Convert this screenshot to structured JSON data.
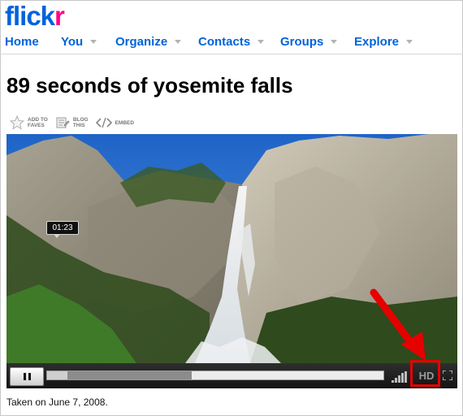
{
  "logo": {
    "main": "flick",
    "accent": "r"
  },
  "nav": {
    "items": [
      {
        "label": "Home",
        "has_menu": false
      },
      {
        "label": "You",
        "has_menu": true
      },
      {
        "label": "Organize",
        "has_menu": true
      },
      {
        "label": "Contacts",
        "has_menu": true
      },
      {
        "label": "Groups",
        "has_menu": true
      },
      {
        "label": "Explore",
        "has_menu": true
      }
    ]
  },
  "video_title": "89 seconds of yosemite falls",
  "actions": {
    "add_to_faves_line1": "ADD TO",
    "add_to_faves_line2": "FAVES",
    "blog_this_line1": "BLOG",
    "blog_this_line2": "THIS",
    "embed": "EMBED"
  },
  "player": {
    "time_tooltip": "01:23",
    "hd_label": "HD",
    "played_fraction": 0.06,
    "buffered_fraction": 0.43
  },
  "caption": "Taken on June 7, 2008.",
  "colors": {
    "logo_blue": "#0063dc",
    "logo_pink": "#ff0084",
    "nav_link": "#0063dc",
    "highlight_red": "#e60000"
  },
  "icons": {
    "fave": "star-icon",
    "blog": "blog-icon",
    "embed": "code-brackets-icon",
    "pause": "pause-icon",
    "signal": "signal-bars-icon",
    "fullscreen": "fullscreen-icon"
  }
}
